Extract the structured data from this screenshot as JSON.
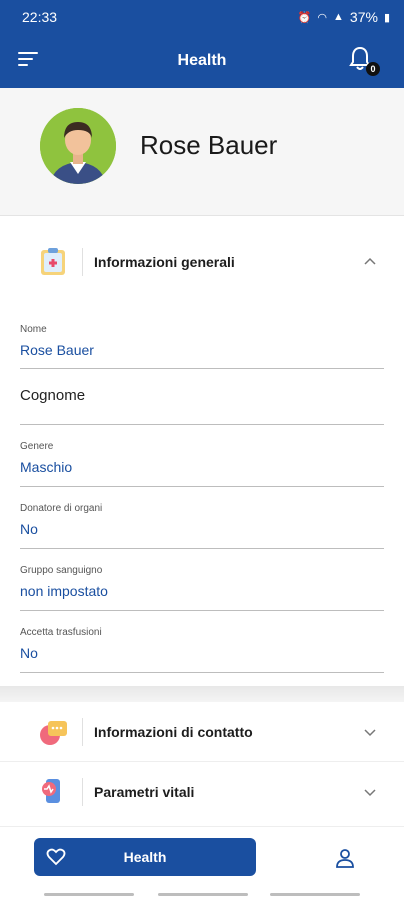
{
  "status_bar": {
    "time": "22:33",
    "battery": "37%"
  },
  "app_bar": {
    "title": "Health",
    "notification_count": "0"
  },
  "profile": {
    "name": "Rose Bauer"
  },
  "general_section": {
    "title": "Informazioni generali",
    "fields": [
      {
        "label": "Nome",
        "value": "Rose Bauer"
      },
      {
        "label": "",
        "value": "Cognome"
      },
      {
        "label": "Genere",
        "value": "Maschio"
      },
      {
        "label": "Donatore di organi",
        "value": "No"
      },
      {
        "label": "Gruppo sanguigno",
        "value": "non impostato"
      },
      {
        "label": "Accetta trasfusioni",
        "value": "No"
      }
    ]
  },
  "contact_section": {
    "title": "Informazioni di contatto"
  },
  "vitals_section": {
    "title": "Parametri vitali"
  },
  "bottom_nav": {
    "health_label": "Health"
  },
  "colors": {
    "primary": "#1a4fa0",
    "avatar_bg": "#8fc33e"
  },
  "icons": [
    "menu-icon",
    "bell-icon",
    "clipboard-icon",
    "chat-icon",
    "vitals-icon",
    "chevron-up-icon",
    "chevron-down-icon",
    "heart-icon",
    "user-icon"
  ]
}
